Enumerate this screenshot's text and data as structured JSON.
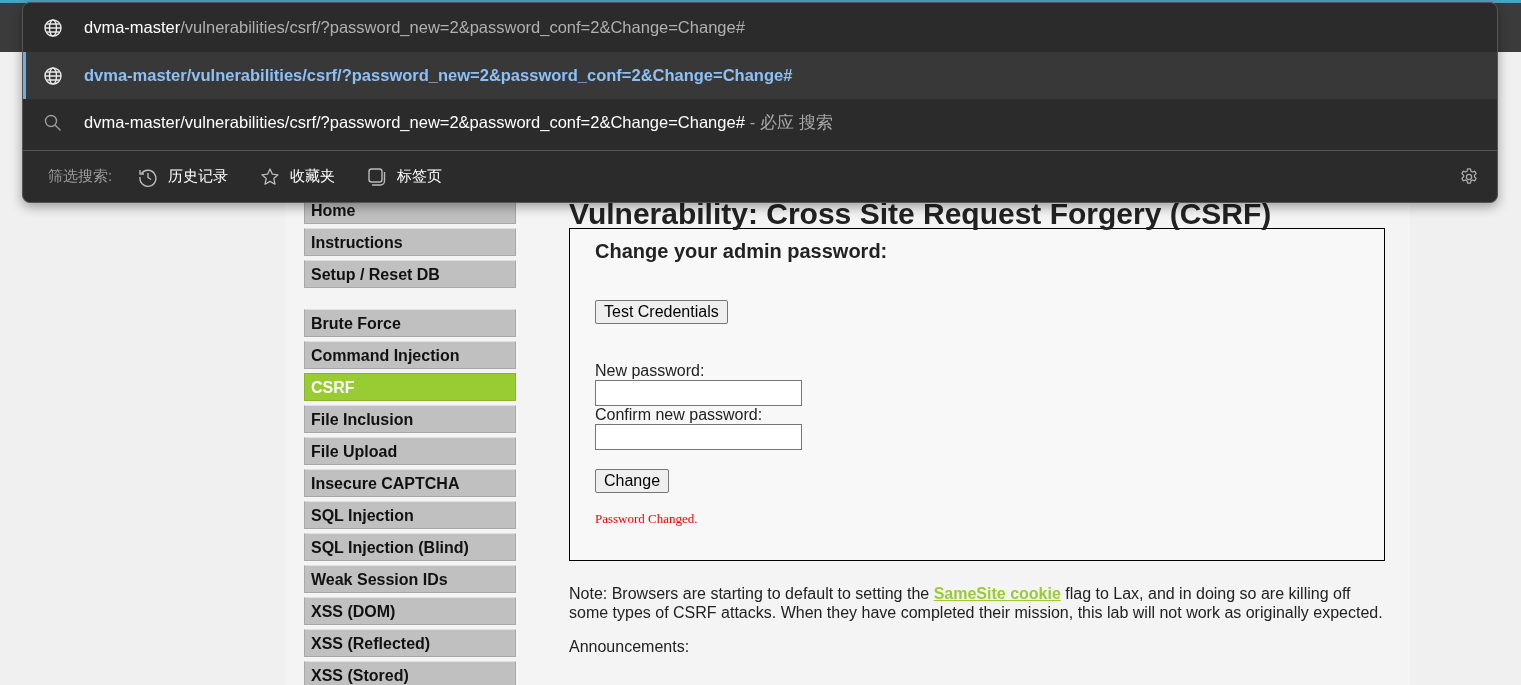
{
  "omnibox": {
    "suggestions": [
      {
        "kind": "url",
        "domain": "dvma-master",
        "path": "/vulnerabilities/csrf/?password_new=2&password_conf=2&Change=Change#",
        "selected": false
      },
      {
        "kind": "url",
        "domain": "dvma-master",
        "path": "/vulnerabilities/csrf/?password_new=2&password_conf=2&Change=Change#",
        "selected": true
      },
      {
        "kind": "search",
        "query": "dvma-master/vulnerabilities/csrf/?password_new=2&password_conf=2&Change=Change#",
        "suffix": "- 必应 搜索",
        "selected": false
      }
    ],
    "filter_label": "筛选搜索:",
    "filters": [
      {
        "kind": "history",
        "label": "历史记录"
      },
      {
        "kind": "favorites",
        "label": "收藏夹"
      },
      {
        "kind": "tabs",
        "label": "标签页"
      }
    ]
  },
  "page": {
    "heading": "Vulnerability: Cross Site Request Forgery (CSRF)",
    "menu": [
      [
        {
          "label": "Home",
          "selected": false
        },
        {
          "label": "Instructions",
          "selected": false
        },
        {
          "label": "Setup / Reset DB",
          "selected": false
        }
      ],
      [
        {
          "label": "Brute Force",
          "selected": false
        },
        {
          "label": "Command Injection",
          "selected": false
        },
        {
          "label": "CSRF",
          "selected": true
        },
        {
          "label": "File Inclusion",
          "selected": false
        },
        {
          "label": "File Upload",
          "selected": false
        },
        {
          "label": "Insecure CAPTCHA",
          "selected": false
        },
        {
          "label": "SQL Injection",
          "selected": false
        },
        {
          "label": "SQL Injection (Blind)",
          "selected": false
        },
        {
          "label": "Weak Session IDs",
          "selected": false
        },
        {
          "label": "XSS (DOM)",
          "selected": false
        },
        {
          "label": "XSS (Reflected)",
          "selected": false
        },
        {
          "label": "XSS (Stored)",
          "selected": false
        }
      ]
    ],
    "form": {
      "title": "Change your admin password:",
      "test_button": "Test Credentials",
      "new_label": "New password:",
      "confirm_label": "Confirm new password:",
      "submit_button": "Change",
      "message": "Password Changed."
    },
    "note": {
      "before": "Note: Browsers are starting to default to setting the",
      "link": "SameSite cookie",
      "after": "flag to Lax, and in doing so are killing off some types of CSRF attacks. When they have completed their mission, this lab will not work as originally expected."
    },
    "announcements": "Announcements:"
  }
}
